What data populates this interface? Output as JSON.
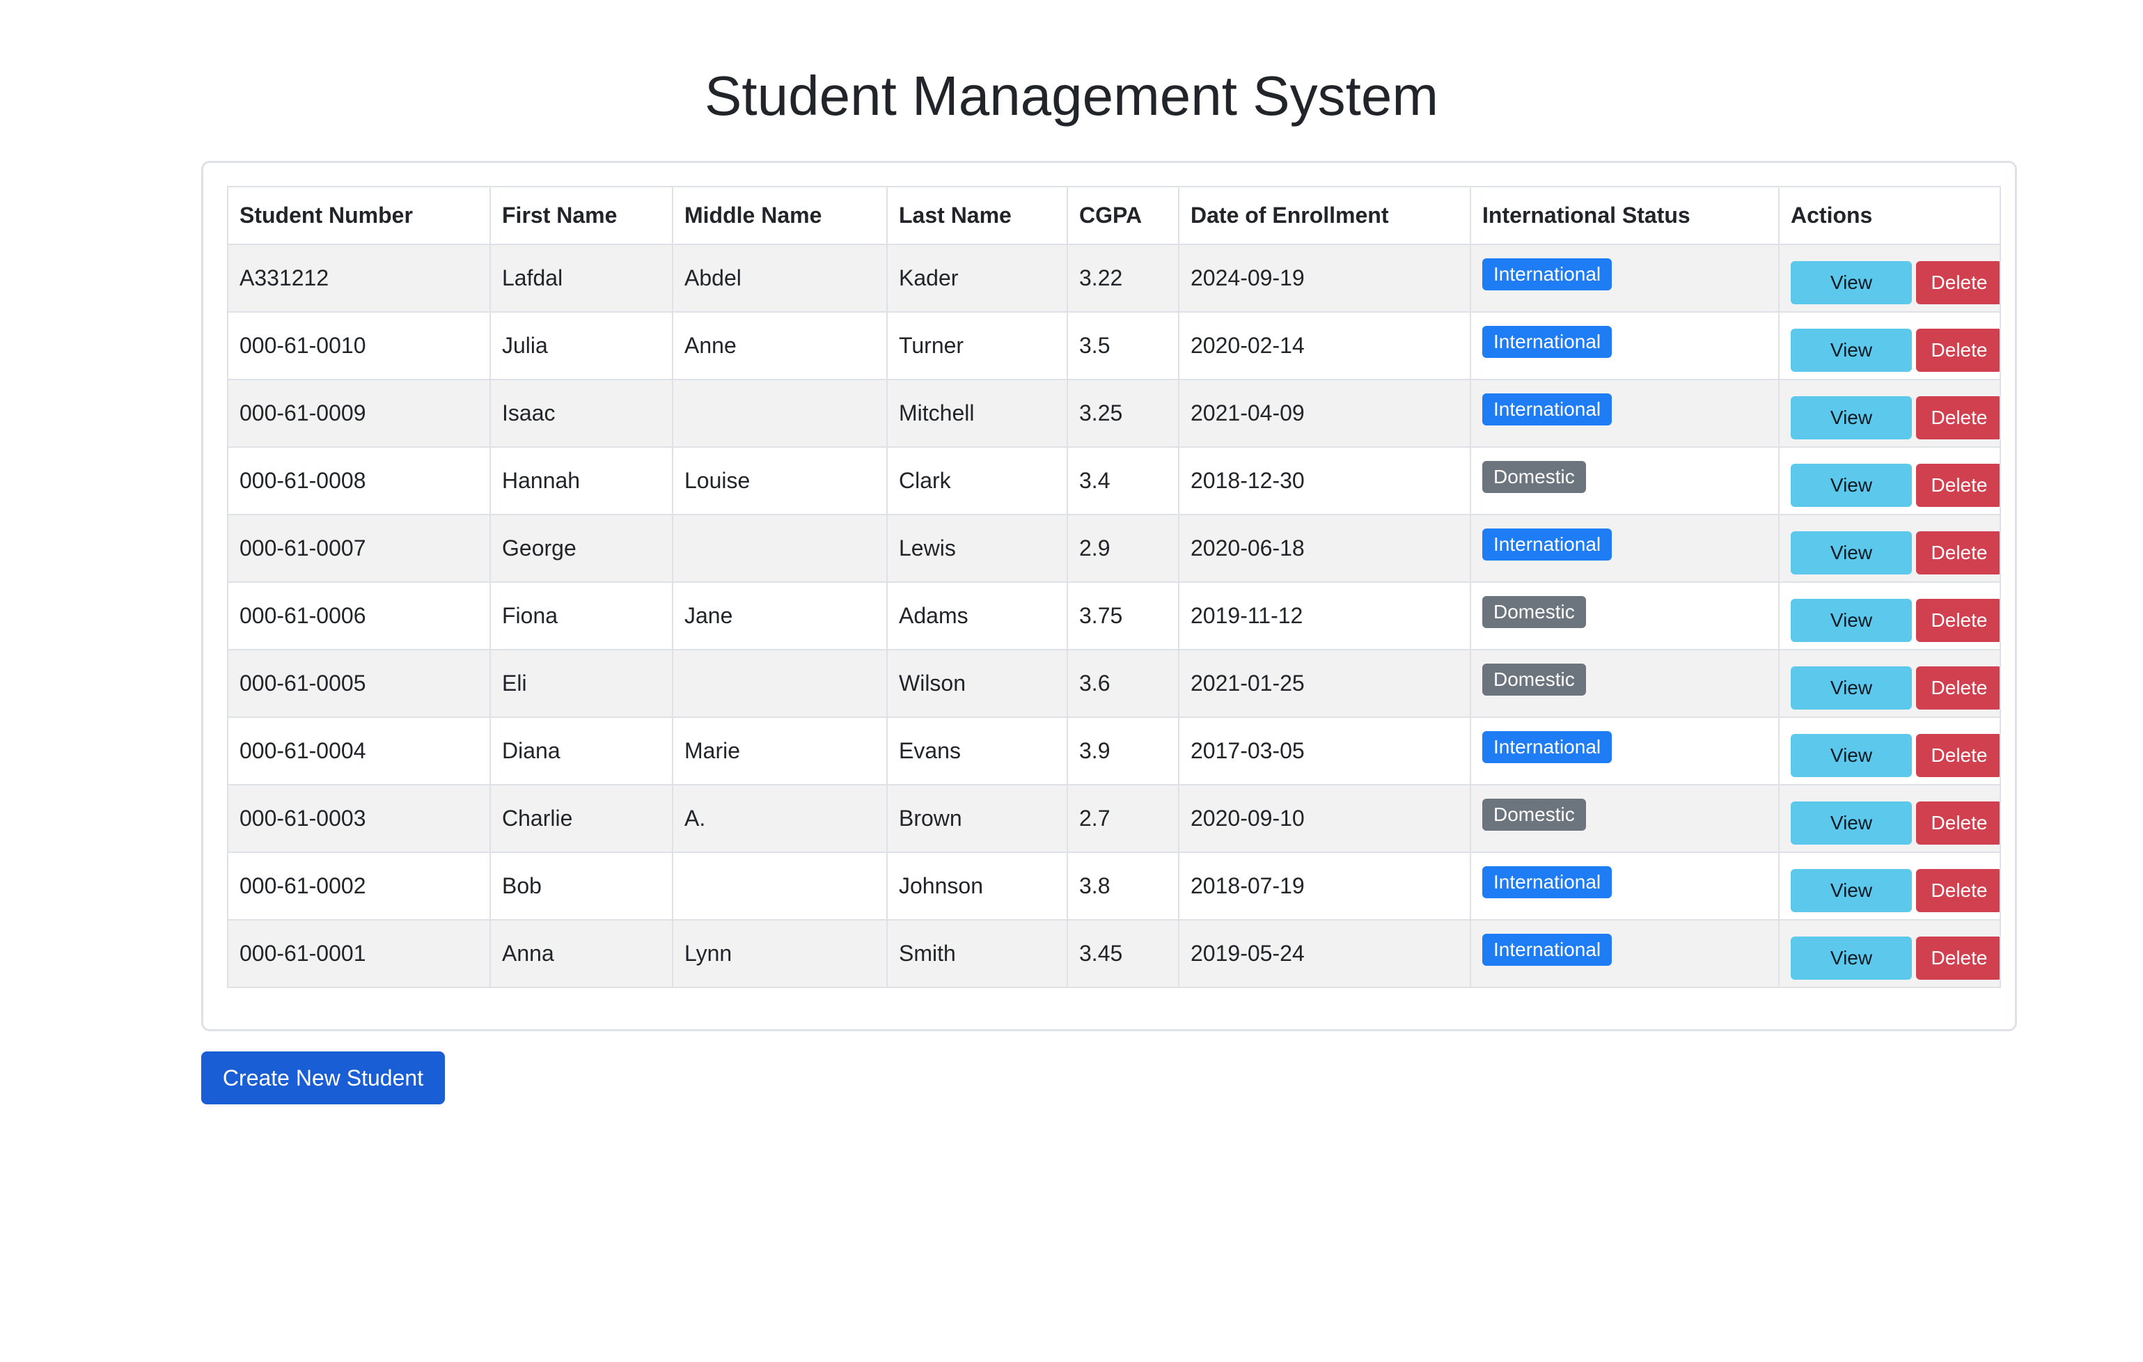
{
  "page": {
    "title": "Student Management System"
  },
  "table": {
    "headers": [
      "Student Number",
      "First Name",
      "Middle Name",
      "Last Name",
      "CGPA",
      "Date of Enrollment",
      "International Status",
      "Actions"
    ],
    "rows": [
      {
        "student_number": "A331212",
        "first_name": "Lafdal",
        "middle_name": "Abdel",
        "last_name": "Kader",
        "cgpa": "3.22",
        "date": "2024-09-19",
        "status": "International"
      },
      {
        "student_number": "000-61-0010",
        "first_name": "Julia",
        "middle_name": "Anne",
        "last_name": "Turner",
        "cgpa": "3.5",
        "date": "2020-02-14",
        "status": "International"
      },
      {
        "student_number": "000-61-0009",
        "first_name": "Isaac",
        "middle_name": "",
        "last_name": "Mitchell",
        "cgpa": "3.25",
        "date": "2021-04-09",
        "status": "International"
      },
      {
        "student_number": "000-61-0008",
        "first_name": "Hannah",
        "middle_name": "Louise",
        "last_name": "Clark",
        "cgpa": "3.4",
        "date": "2018-12-30",
        "status": "Domestic"
      },
      {
        "student_number": "000-61-0007",
        "first_name": "George",
        "middle_name": "",
        "last_name": "Lewis",
        "cgpa": "2.9",
        "date": "2020-06-18",
        "status": "International"
      },
      {
        "student_number": "000-61-0006",
        "first_name": "Fiona",
        "middle_name": "Jane",
        "last_name": "Adams",
        "cgpa": "3.75",
        "date": "2019-11-12",
        "status": "Domestic"
      },
      {
        "student_number": "000-61-0005",
        "first_name": "Eli",
        "middle_name": "",
        "last_name": "Wilson",
        "cgpa": "3.6",
        "date": "2021-01-25",
        "status": "Domestic"
      },
      {
        "student_number": "000-61-0004",
        "first_name": "Diana",
        "middle_name": "Marie",
        "last_name": "Evans",
        "cgpa": "3.9",
        "date": "2017-03-05",
        "status": "International"
      },
      {
        "student_number": "000-61-0003",
        "first_name": "Charlie",
        "middle_name": "A.",
        "last_name": "Brown",
        "cgpa": "2.7",
        "date": "2020-09-10",
        "status": "Domestic"
      },
      {
        "student_number": "000-61-0002",
        "first_name": "Bob",
        "middle_name": "",
        "last_name": "Johnson",
        "cgpa": "3.8",
        "date": "2018-07-19",
        "status": "International"
      },
      {
        "student_number": "000-61-0001",
        "first_name": "Anna",
        "middle_name": "Lynn",
        "last_name": "Smith",
        "cgpa": "3.45",
        "date": "2019-05-24",
        "status": "International"
      }
    ],
    "view_label": "View",
    "delete_label": "Delete"
  },
  "create_button": {
    "label": "Create New Student"
  },
  "colors": {
    "international": "#1e7cf5",
    "domestic": "#6c757d",
    "view": "#5bc8ec",
    "delete": "#d0404f",
    "primary": "#1a5ed6"
  }
}
